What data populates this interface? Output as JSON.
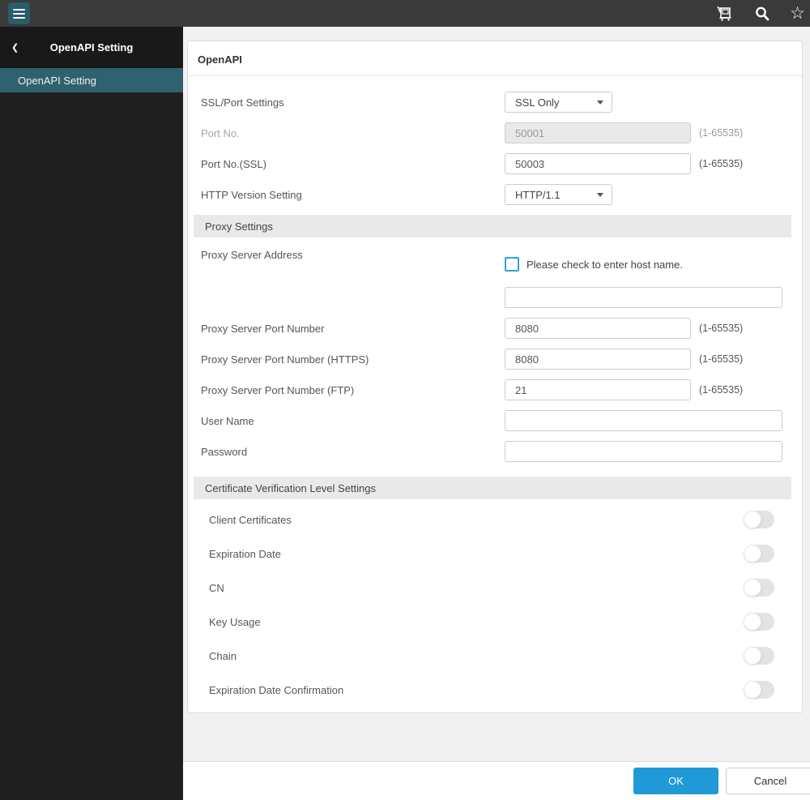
{
  "colors": {
    "accent_teal": "#30616f",
    "accent_blue": "#1f9ad6",
    "checkbox_blue": "#2ea3db",
    "topbar_bg": "#3a3a3a",
    "sidebar_bg": "#1f1f1f"
  },
  "topbar": {
    "icons": [
      "hamburger-icon",
      "printer-icon",
      "search-icon",
      "star-icon"
    ]
  },
  "sidebar": {
    "back_icon": "chevron-left-icon",
    "title": "OpenAPI Setting",
    "items": [
      {
        "label": "OpenAPI Setting",
        "active": true
      }
    ]
  },
  "form": {
    "title": "OpenAPI",
    "ssl_port": {
      "label": "SSL/Port Settings",
      "value": "SSL Only"
    },
    "port": {
      "label": "Port No.",
      "value": "50001",
      "hint": "(1-65535)",
      "disabled": true
    },
    "port_ssl": {
      "label": "Port No.(SSL)",
      "value": "50003",
      "hint": "(1-65535)"
    },
    "http_version": {
      "label": "HTTP Version Setting",
      "value": "HTTP/1.1"
    },
    "proxy_section_title": "Proxy Settings",
    "proxy_address": {
      "label": "Proxy Server Address",
      "checkbox_label": "Please check to enter host name.",
      "checked": false,
      "value": ""
    },
    "proxy_port": {
      "label": "Proxy Server Port Number",
      "value": "8080",
      "hint": "(1-65535)"
    },
    "proxy_port_https": {
      "label": "Proxy Server Port Number (HTTPS)",
      "value": "8080",
      "hint": "(1-65535)"
    },
    "proxy_port_ftp": {
      "label": "Proxy Server Port Number (FTP)",
      "value": "21",
      "hint": "(1-65535)"
    },
    "user_name": {
      "label": "User Name",
      "value": ""
    },
    "password": {
      "label": "Password",
      "value": ""
    },
    "cert_section_title": "Certificate Verification Level Settings",
    "toggles": [
      {
        "label": "Client Certificates",
        "on": false
      },
      {
        "label": "Expiration Date",
        "on": false
      },
      {
        "label": "CN",
        "on": false
      },
      {
        "label": "Key Usage",
        "on": false
      },
      {
        "label": "Chain",
        "on": false
      },
      {
        "label": "Expiration Date Confirmation",
        "on": false
      }
    ]
  },
  "footer": {
    "ok_label": "OK",
    "cancel_label": "Cancel"
  }
}
